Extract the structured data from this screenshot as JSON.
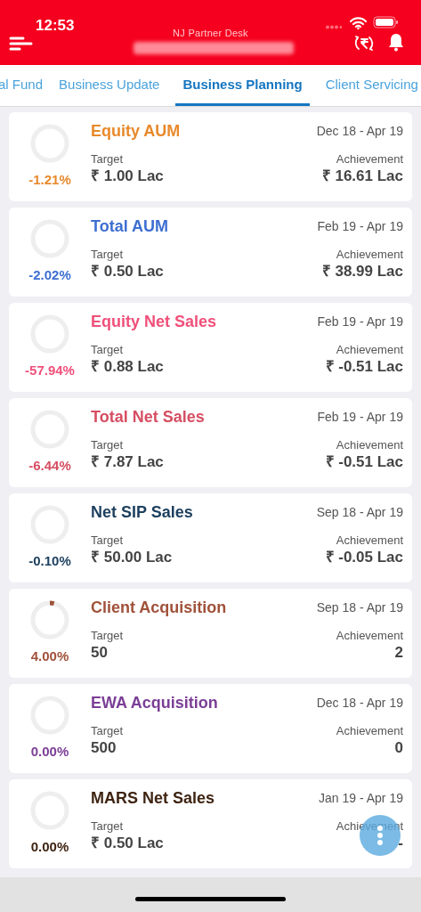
{
  "status_bar": {
    "time": "12:53"
  },
  "header": {
    "title": "NJ Partner Desk"
  },
  "tabs": [
    {
      "label": "al Fund",
      "selected": false
    },
    {
      "label": "Business Update",
      "selected": false
    },
    {
      "label": "Business Planning",
      "selected": true
    },
    {
      "label": "Client Servicing",
      "selected": false
    }
  ],
  "cards": [
    {
      "title": "Equity AUM",
      "color": "#e8892b",
      "percent": "-1.21%",
      "level": 0,
      "period": "Dec 18 - Apr 19",
      "target_label": "Target",
      "target": "₹ 1.00 Lac",
      "achievement_label": "Achievement",
      "achievement": "₹ 16.61 Lac"
    },
    {
      "title": "Total AUM",
      "color": "#3d6fd1",
      "percent": "-2.02%",
      "level": 0,
      "period": "Feb 19 - Apr 19",
      "target_label": "Target",
      "target": "₹ 0.50 Lac",
      "achievement_label": "Achievement",
      "achievement": "₹ 38.99 Lac"
    },
    {
      "title": "Equity Net Sales",
      "color": "#f0507a",
      "percent": "-57.94%",
      "level": 0,
      "period": "Feb 19 - Apr 19",
      "target_label": "Target",
      "target": "₹ 0.88 Lac",
      "achievement_label": "Achievement",
      "achievement": "₹ -0.51 Lac"
    },
    {
      "title": "Total Net Sales",
      "color": "#d64e62",
      "percent": "-6.44%",
      "level": 0,
      "period": "Feb 19 - Apr 19",
      "target_label": "Target",
      "target": "₹ 7.87 Lac",
      "achievement_label": "Achievement",
      "achievement": "₹ -0.51 Lac"
    },
    {
      "title": "Net SIP Sales",
      "color": "#1c3f5e",
      "percent": "-0.10%",
      "level": 0,
      "period": "Sep 18 - Apr 19",
      "target_label": "Target",
      "target": "₹ 50.00 Lac",
      "achievement_label": "Achievement",
      "achievement": "₹ -0.05 Lac"
    },
    {
      "title": "Client Acquisition",
      "color": "#a0523a",
      "percent": "4.00%",
      "level": 0.04,
      "period": "Sep 18 - Apr 19",
      "target_label": "Target",
      "target": "50",
      "achievement_label": "Achievement",
      "achievement": "2"
    },
    {
      "title": "EWA Acquisition",
      "color": "#7b3e96",
      "percent": "0.00%",
      "level": 0,
      "period": "Dec 18 - Apr 19",
      "target_label": "Target",
      "target": "500",
      "achievement_label": "Achievement",
      "achievement": "0"
    },
    {
      "title": "MARS Net Sales",
      "color": "#3e2412",
      "percent": "0.00%",
      "level": 0,
      "period": "Jan 19 - Apr 19",
      "target_label": "Target",
      "target": "₹ 0.50 Lac",
      "achievement_label": "Achievement",
      "achievement": "-"
    }
  ]
}
